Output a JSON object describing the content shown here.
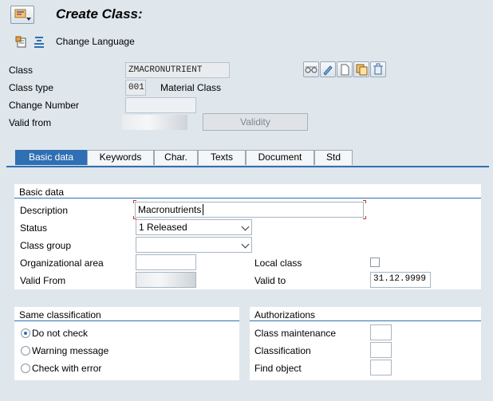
{
  "header": {
    "title": "Create Class:",
    "menu_icon": "sap-menu-icon"
  },
  "toolbar": {
    "change_language_label": "Change Language"
  },
  "class_section": {
    "class_label": "Class",
    "class_value": "ZMACRONUTRIENT",
    "class_type_label": "Class type",
    "class_type_value": "001",
    "class_type_text": "Material Class",
    "change_number_label": "Change Number",
    "valid_from_label": "Valid from",
    "validity_button": "Validity"
  },
  "tabs": [
    {
      "label": "Basic data"
    },
    {
      "label": "Keywords"
    },
    {
      "label": "Char."
    },
    {
      "label": "Texts"
    },
    {
      "label": "Document"
    },
    {
      "label": "Std"
    }
  ],
  "basic_data": {
    "group_title": "Basic data",
    "description_label": "Description",
    "description_value": "Macronutrients",
    "status_label": "Status",
    "status_value": "1 Released",
    "class_group_label": "Class group",
    "org_area_label": "Organizational area",
    "local_class_label": "Local class",
    "valid_from_label": "Valid From",
    "valid_to_label": "Valid to",
    "valid_to_value": "31.12.9999"
  },
  "same_classification": {
    "title": "Same classification",
    "options": [
      {
        "label": "Do not check",
        "checked": true
      },
      {
        "label": "Warning message",
        "checked": false
      },
      {
        "label": "Check with error",
        "checked": false
      }
    ]
  },
  "authorizations": {
    "title": "Authorizations",
    "class_maintenance_label": "Class maintenance",
    "classification_label": "Classification",
    "find_object_label": "Find object"
  },
  "colors": {
    "accent": "#2f6fb3",
    "background": "#dfe6ec"
  }
}
